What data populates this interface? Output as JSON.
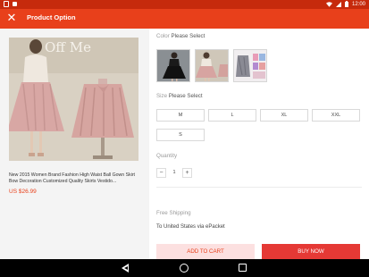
{
  "status_bar": {
    "time": "12:00",
    "icons": [
      "app-notification-icon",
      "shopping-bag-icon",
      "wifi-icon",
      "signal-icon",
      "battery-icon"
    ]
  },
  "app_bar": {
    "close_icon": "close-icon",
    "close_glyph": "✕",
    "title": "Product Option"
  },
  "product": {
    "title": "New 2015 Women Brand Fashion High Waist Ball Gown Skirt Bow Decoration Customized Quality Skirts Vestido...",
    "price": "US $26.99",
    "image_text": "Off Me"
  },
  "color_section": {
    "label": "Color",
    "selected": "Please Select"
  },
  "size_section": {
    "label": "Size",
    "selected": "Please Select",
    "options": [
      "M",
      "L",
      "XL",
      "XXL",
      "S"
    ]
  },
  "quantity_section": {
    "label": "Quantity",
    "minus": "−",
    "value": "1",
    "plus": "+"
  },
  "shipping": {
    "label": "Free Shipping",
    "value": "To United States via ePacket"
  },
  "actions": {
    "add_to_cart": "ADD TO CART",
    "buy_now": "BUY NOW"
  },
  "colors": {
    "accent": "#e8401b",
    "status_bar": "#c62a0c",
    "buy_button": "#e53935",
    "add_button_bg": "#fce0e0"
  }
}
